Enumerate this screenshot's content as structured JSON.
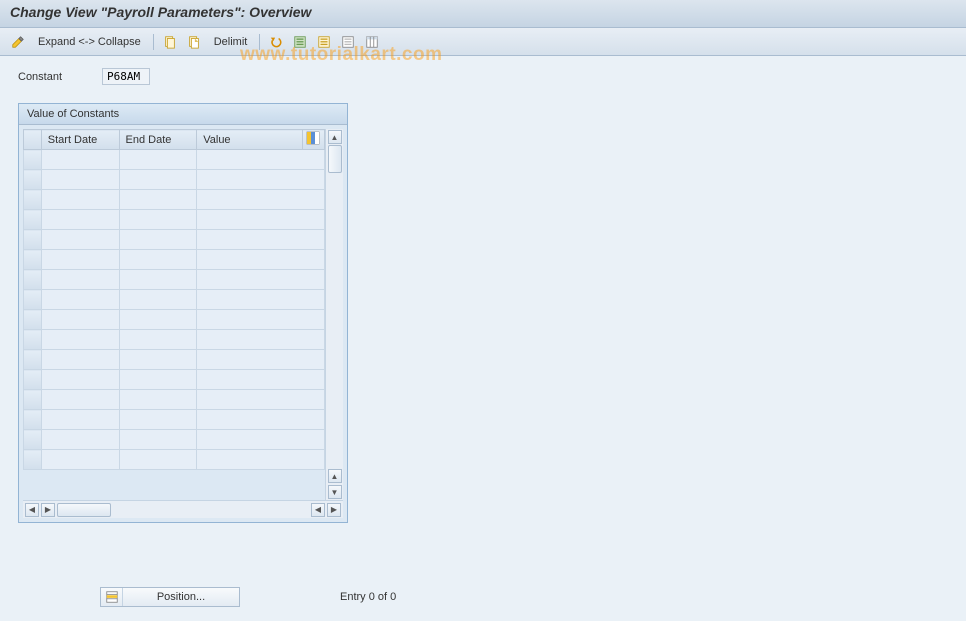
{
  "title": "Change View \"Payroll Parameters\": Overview",
  "toolbar": {
    "expand_label": "Expand <-> Collapse",
    "delimit_label": "Delimit"
  },
  "field": {
    "constant_label": "Constant",
    "constant_value": "P68AM"
  },
  "panel": {
    "title": "Value of Constants",
    "columns": [
      "Start Date",
      "End Date",
      "Value"
    ]
  },
  "footer": {
    "position_label": "Position...",
    "entry_text": "Entry 0 of 0"
  },
  "watermark": "www.tutorialkart.com"
}
